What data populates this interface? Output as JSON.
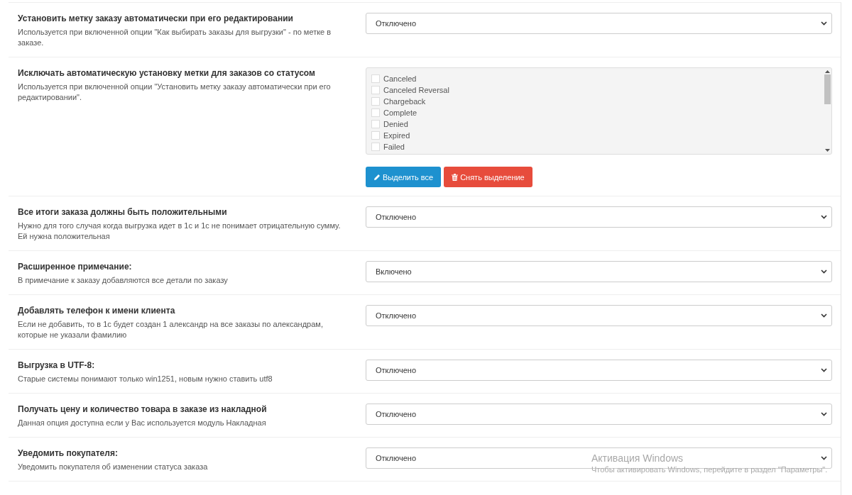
{
  "settings": [
    {
      "kind": "select",
      "title": "Установить метку заказу автоматически при его редактировании",
      "description": "Используется при включенной опции \"Как выбирать заказы для выгрузки\" - по метке в заказе.",
      "value": "Отключено"
    },
    {
      "kind": "checklist",
      "title": "Исключать автоматическую установку метки для заказов со статусом",
      "description": "Используется при включенной опции \"Установить метку заказу автоматически при его редактировании\".",
      "options": [
        {
          "label": "Canceled",
          "checked": false
        },
        {
          "label": "Canceled Reversal",
          "checked": false
        },
        {
          "label": "Chargeback",
          "checked": false
        },
        {
          "label": "Complete",
          "checked": false
        },
        {
          "label": "Denied",
          "checked": false
        },
        {
          "label": "Expired",
          "checked": false
        },
        {
          "label": "Failed",
          "checked": false
        }
      ],
      "buttons": [
        {
          "kind": "select_all",
          "label": "Выделить все"
        },
        {
          "kind": "clear",
          "label": "Снять выделение"
        }
      ]
    },
    {
      "kind": "select",
      "title": "Все итоги заказа должны быть положительными",
      "description": "Нужно для того случая когда выгрузка идет в 1с и 1с не понимает отрицательную сумму. Ей нужна положительная",
      "value": "Отключено"
    },
    {
      "kind": "select",
      "title": "Расширенное примечание:",
      "description": "В примечание к заказу добавляются все детали по заказу",
      "value": "Включено"
    },
    {
      "kind": "select",
      "title": "Добавлять телефон к имени клиента",
      "description": "Если не добавить, то в 1с будет создан 1 александр на все заказы по александрам, которые не указали фамилию",
      "value": "Отключено"
    },
    {
      "kind": "select",
      "title": "Выгрузка в UTF-8:",
      "description": "Старые системы понимают только win1251, новым нужно ставить utf8",
      "value": "Отключено"
    },
    {
      "kind": "select",
      "title": "Получать цену и количество товара в заказе из накладной",
      "description": "Данная опция доступна если у Вас используется модуль Накладная",
      "value": "Отключено"
    },
    {
      "kind": "select",
      "title": "Уведомить покупателя:",
      "description": "Уведомить покупателя об изменении статуса заказа",
      "value": "Отключено"
    }
  ],
  "activation_notice": {
    "title": "Активация Windows",
    "text": "Чтобы активировать Windows, перейдите в раздел \"Параметры\"."
  }
}
